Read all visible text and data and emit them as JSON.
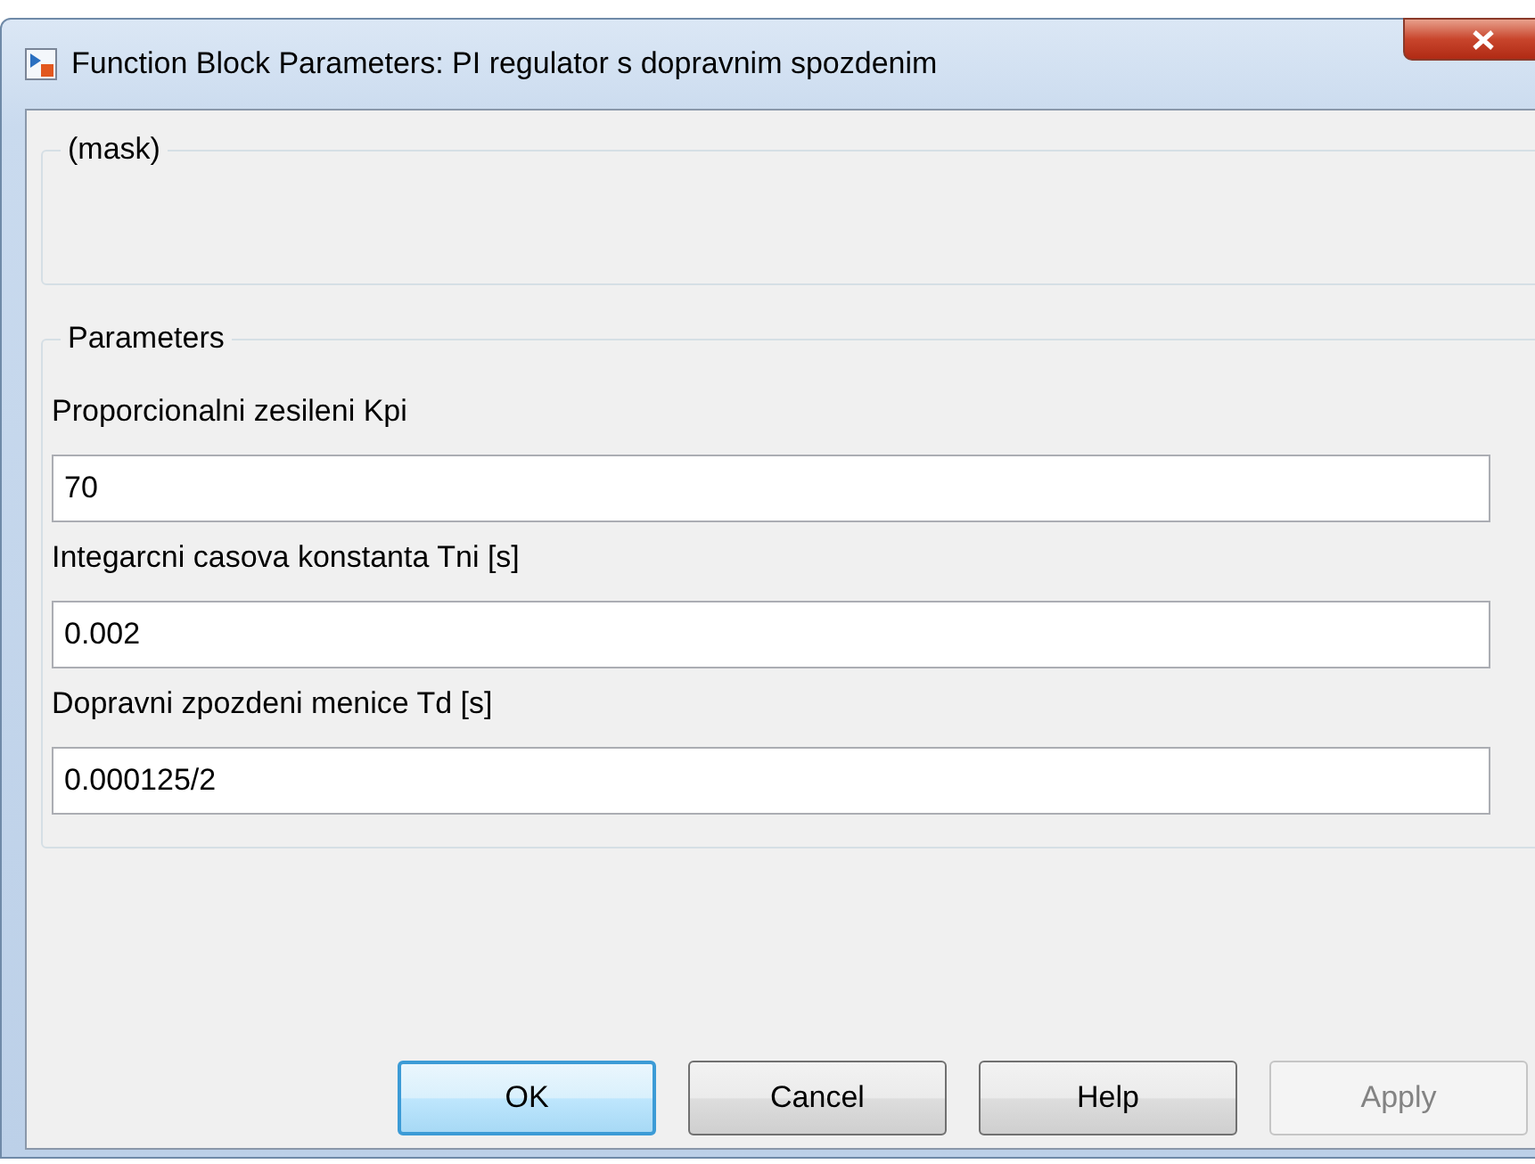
{
  "window": {
    "title": "Function Block Parameters: PI regulator s dopravnim spozdenim"
  },
  "mask_group": {
    "title": "(mask)"
  },
  "parameters_group": {
    "title": "Parameters",
    "fields": [
      {
        "label": "Proporcionalni zesileni Kpi",
        "value": "70"
      },
      {
        "label": "Integarcni casova konstanta Tni [s]",
        "value": "0.002"
      },
      {
        "label": "Dopravni zpozdeni menice Td [s]",
        "value": "0.000125/2"
      }
    ]
  },
  "buttons": [
    {
      "label": "OK",
      "default": true,
      "disabled": false
    },
    {
      "label": "Cancel",
      "default": false,
      "disabled": false
    },
    {
      "label": "Help",
      "default": false,
      "disabled": false
    },
    {
      "label": "Apply",
      "default": false,
      "disabled": true
    }
  ]
}
